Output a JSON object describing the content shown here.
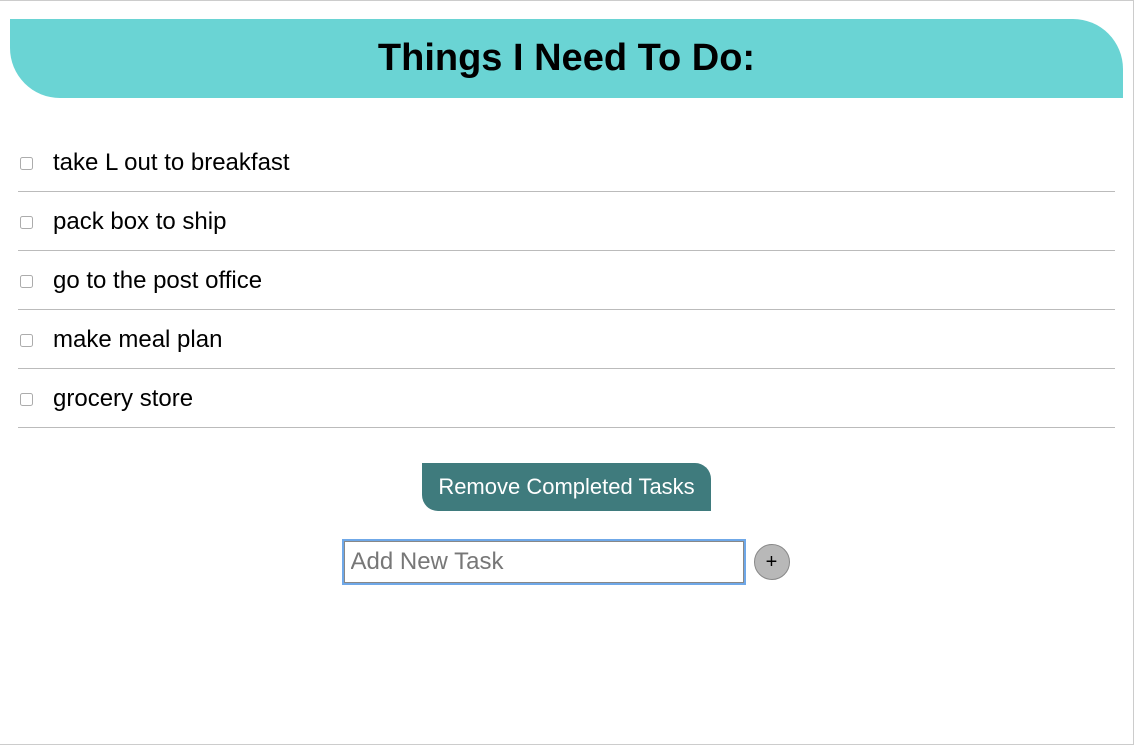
{
  "header": {
    "title": "Things I Need To Do:"
  },
  "tasks": [
    {
      "label": "take L out to breakfast",
      "done": false
    },
    {
      "label": "pack box to ship",
      "done": false
    },
    {
      "label": "go to the post office",
      "done": false
    },
    {
      "label": "make meal plan",
      "done": false
    },
    {
      "label": "grocery store",
      "done": false
    }
  ],
  "controls": {
    "remove_label": "Remove Completed Tasks",
    "add_placeholder": "Add New Task",
    "add_button_label": "+"
  }
}
